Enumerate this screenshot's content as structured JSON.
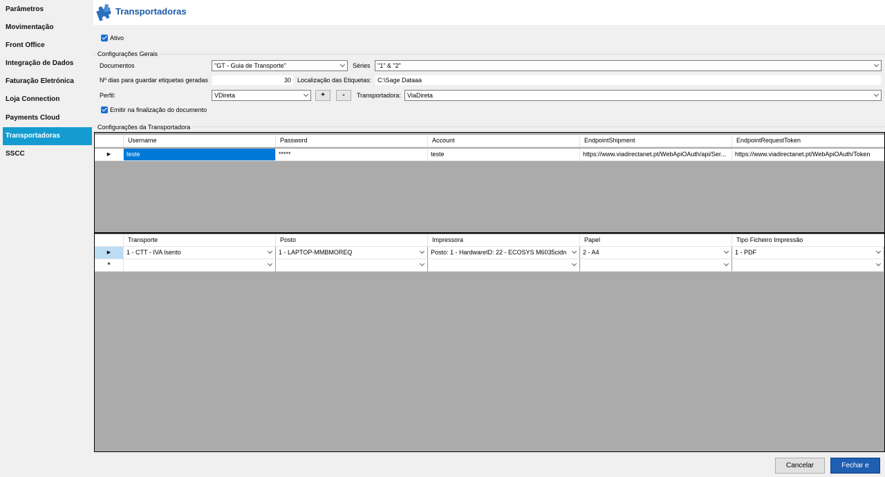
{
  "sidebar": {
    "items": [
      {
        "label": "Parâmetros"
      },
      {
        "label": "Movimentação"
      },
      {
        "label": "Front Office"
      },
      {
        "label": "Integração de Dados"
      },
      {
        "label": "Faturação Eletrónica"
      },
      {
        "label": "Loja Connection"
      },
      {
        "label": "Payments Cloud"
      },
      {
        "label": "Transportadoras",
        "active": true
      },
      {
        "label": "SSCC"
      }
    ]
  },
  "header": {
    "title": "Transportadoras",
    "icon": "puzzle-icon"
  },
  "ativo": {
    "label": "Ativo",
    "checked": true
  },
  "config_gerais": {
    "title": "Configurações Gerais",
    "documentos_label": "Documentos",
    "documentos_value": "\"GT - Guia de Transporte\"",
    "series_label": "Séries",
    "series_value": "\"1\" & \"2\"",
    "dias_label": "Nº dias para guardar etiquetas geradas",
    "dias_value": "30",
    "localizacao_label": "Localização das Etiquetas:",
    "localizacao_value": "C:\\Sage Dataaa",
    "perfil_label": "Perfil:",
    "perfil_value": "VDireta",
    "add_label": "+",
    "remove_label": "-",
    "transportadora_label": "Transportadora:",
    "transportadora_value": "ViaDireta",
    "emitir_label": "Emitir na finalização do documento",
    "emitir_checked": true
  },
  "config_transportadora": {
    "title": "Configurações da Transportadora",
    "columns": [
      "Username",
      "Password",
      "Account",
      "EndpointShipment",
      "EndpointRequestToken"
    ],
    "rows": [
      [
        "teste",
        "*****",
        "teste",
        "https://www.viadirectanet.pt/WebApiOAuth/api/Ser...",
        "https://www.viadirectanet.pt/WebApiOAuth/Token"
      ]
    ]
  },
  "impressao": {
    "columns": [
      "Transporte",
      "Posto",
      "Impressora",
      "Papel",
      "Tipo Ficheiro Impressão"
    ],
    "rows": [
      [
        "1 - CTT - IVA Isento",
        "1 - LAPTOP-MMBMOREQ",
        "Posto: 1 - HardwareID: 22 - ECOSYS M6035cidn",
        "2 - A4",
        "1 - PDF"
      ]
    ],
    "new_row_marker": "*",
    "current_row_marker": "▶"
  },
  "footer": {
    "cancel_label": "Cancelar",
    "save_label": "Fechar e gravar"
  },
  "colors": {
    "sidebar_active": "#149cd0",
    "title": "#1d5aa8",
    "selection": "#0078d7",
    "primary_button": "#1f5fb3"
  }
}
